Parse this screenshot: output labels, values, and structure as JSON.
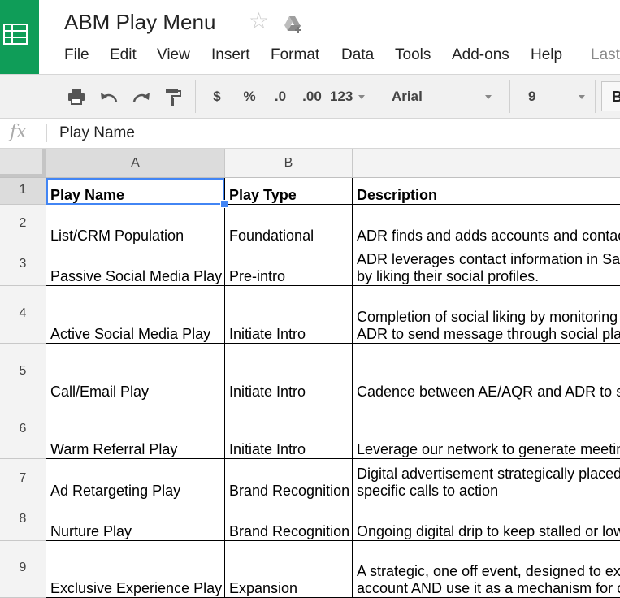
{
  "app": {
    "doc_title": "ABM Play Menu",
    "brand_color": "#0f9d58",
    "selection_color": "#4285f4",
    "icons": [
      "sheets-logo-icon",
      "star-icon",
      "drive-share-icon"
    ]
  },
  "menu": {
    "items": [
      "File",
      "Edit",
      "View",
      "Insert",
      "Format",
      "Data",
      "Tools",
      "Add-ons",
      "Help",
      "Last"
    ]
  },
  "toolbar": {
    "icons": [
      "print-icon",
      "undo-icon",
      "redo-icon",
      "paint-format-icon"
    ],
    "currency": "$",
    "percent": "%",
    "decrease_decimal": ".0",
    "increase_decimal": ".00",
    "number_format": "123",
    "font": "Arial",
    "font_size": "9",
    "bold": "B"
  },
  "formula_bar": {
    "fx": "fx",
    "value": "Play Name"
  },
  "sheet": {
    "columns": [
      "A",
      "B"
    ],
    "selected_cell": "A1",
    "rows": [
      {
        "num": "1",
        "a": [
          "Play Name"
        ],
        "b": [
          "Play Type"
        ],
        "c": [
          "Description"
        ]
      },
      {
        "num": "2",
        "a": [
          "List/CRM Population"
        ],
        "b": [
          "Foundational"
        ],
        "c": [
          "ADR finds and adds accounts and contac"
        ]
      },
      {
        "num": "3",
        "a": [
          "Passive Social Media Play"
        ],
        "b": [
          "Pre-intro"
        ],
        "c": [
          "ADR leverages contact information in Sal",
          "by liking their social profiles."
        ]
      },
      {
        "num": "4",
        "a": [
          "Active Social Media Play"
        ],
        "b": [
          "Initiate Intro"
        ],
        "c": [
          "Completion of social liking by monitoring t",
          "ADR to send message through social plat"
        ]
      },
      {
        "num": "5",
        "a": [
          "Call/Email Play"
        ],
        "b": [
          "Initiate Intro"
        ],
        "c": [
          "Cadence between AE/AQR and ADR to s"
        ]
      },
      {
        "num": "6",
        "a": [
          "Warm Referral Play"
        ],
        "b": [
          "Initiate Intro"
        ],
        "c": [
          "Leverage our network to generate meetin"
        ]
      },
      {
        "num": "7",
        "a": [
          "Ad Retargeting Play"
        ],
        "b": [
          "Brand Recognition"
        ],
        "c": [
          "Digital advertisement strategically placed",
          "specific calls to action"
        ]
      },
      {
        "num": "8",
        "a": [
          "Nurture Play"
        ],
        "b": [
          "Brand Recognition"
        ],
        "c": [
          "Ongoing digital drip to keep stalled or low"
        ]
      },
      {
        "num": "9",
        "a": [
          "Exclusive Experience Play"
        ],
        "b": [
          "Expansion"
        ],
        "c": [
          "A strategic, one off event, designed to exp",
          "account AND use it as a mechanism for c"
        ]
      }
    ]
  }
}
